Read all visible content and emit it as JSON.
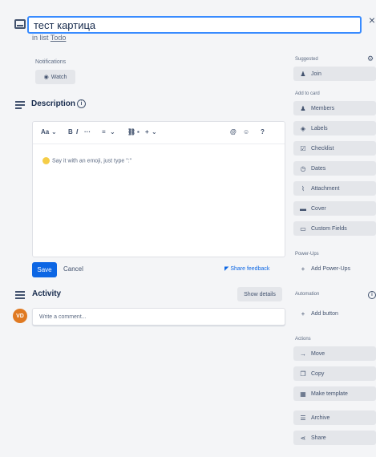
{
  "card": {
    "title": "тест картица",
    "list_prefix": "in list",
    "list_name": "Todo"
  },
  "notifications": {
    "label": "Notifications",
    "watch_label": "Watch",
    "watch_icon": "eye-icon"
  },
  "description": {
    "heading": "Description",
    "toolbar": {
      "text_style": "Aa",
      "bold": "B",
      "italic": "I",
      "more": "···",
      "list": "≡",
      "link": "⛓",
      "image": "▪",
      "insert": "+",
      "mention": "@",
      "emoji_picker": "☺",
      "help": "?"
    },
    "placeholder": "Say it with an emoji, just type \":\"",
    "save_label": "Save",
    "cancel_label": "Cancel",
    "feedback_label": "Share feedback"
  },
  "activity": {
    "heading": "Activity",
    "show_details_label": "Show details",
    "avatar_initials": "VD",
    "comment_placeholder": "Write a comment..."
  },
  "sidebar": {
    "suggested_label": "Suggested",
    "join_label": "Join",
    "add_to_card_label": "Add to card",
    "add_items": [
      {
        "label": "Members",
        "icon": "person-icon"
      },
      {
        "label": "Labels",
        "icon": "tag-icon"
      },
      {
        "label": "Checklist",
        "icon": "checklist-icon"
      },
      {
        "label": "Dates",
        "icon": "clock-icon"
      },
      {
        "label": "Attachment",
        "icon": "paperclip-icon"
      },
      {
        "label": "Cover",
        "icon": "image-icon"
      },
      {
        "label": "Custom Fields",
        "icon": "custom-fields-icon"
      }
    ],
    "power_ups_label": "Power-Ups",
    "add_power_ups_label": "Add Power-Ups",
    "automation_label": "Automation",
    "add_button_label": "Add button",
    "actions_label": "Actions",
    "actions": [
      {
        "label": "Move",
        "icon": "arrow-right-icon"
      },
      {
        "label": "Copy",
        "icon": "copy-icon"
      },
      {
        "label": "Make template",
        "icon": "template-icon"
      },
      {
        "label": "Archive",
        "icon": "archive-icon"
      },
      {
        "label": "Share",
        "icon": "share-icon"
      }
    ]
  }
}
